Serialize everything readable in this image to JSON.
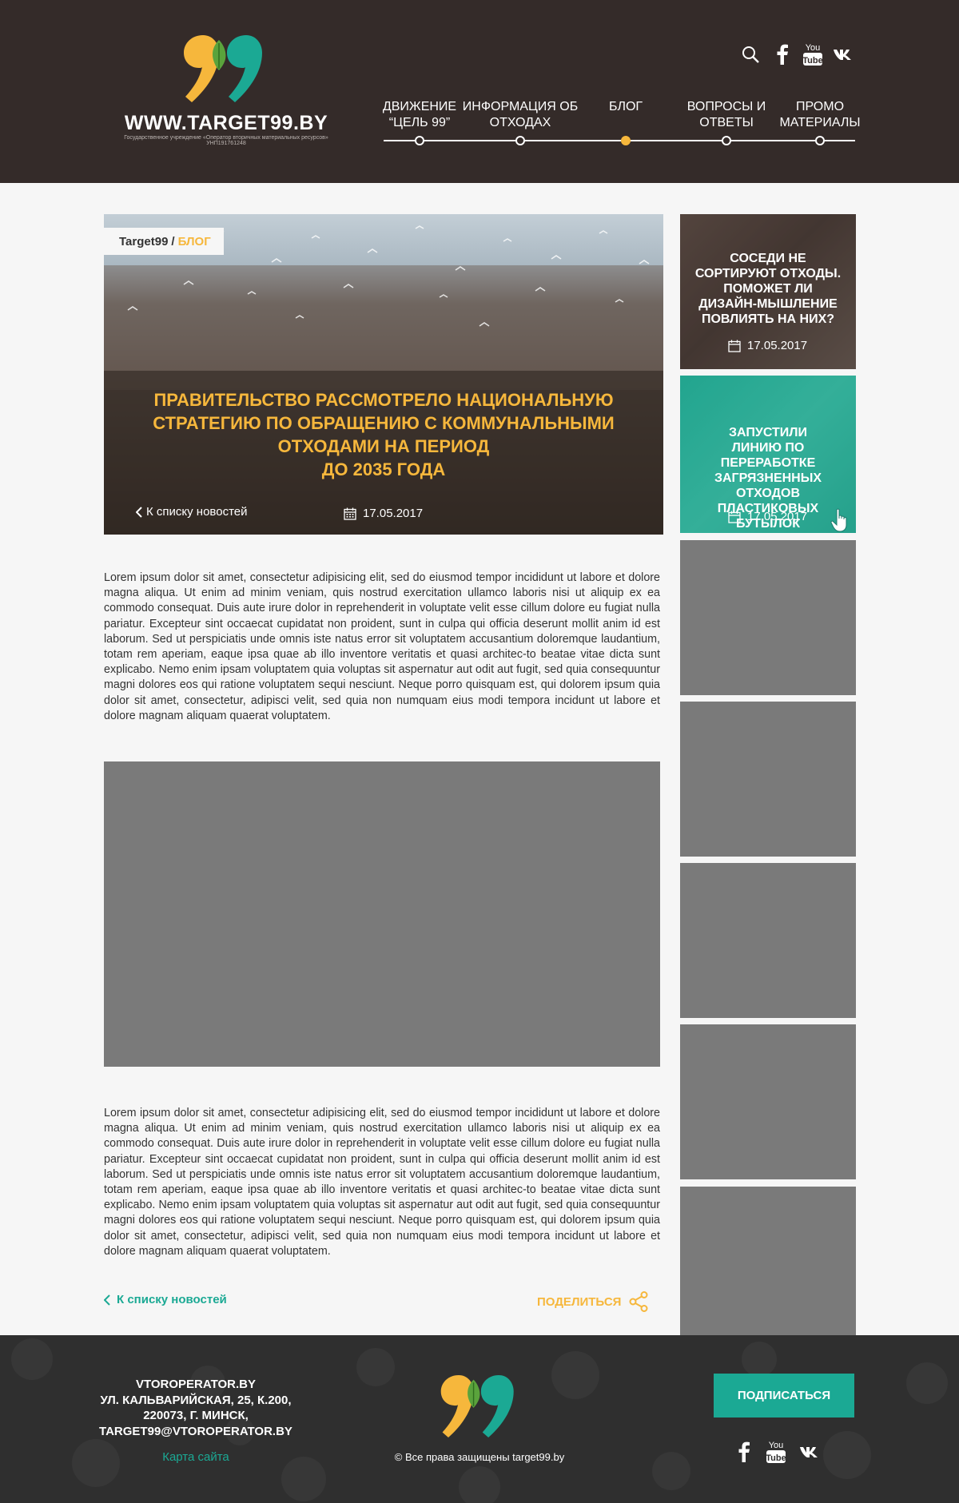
{
  "header": {
    "site_name": "WWW.TARGET99.BY",
    "site_subtitle": "Государственное учреждение «Оператор вторичных материальных ресурсов» УНП191761248",
    "social": [
      "search-icon",
      "facebook-icon",
      "youtube-icon",
      "vk-icon"
    ],
    "nav": [
      {
        "label_line1": "ДВИЖЕНИЕ",
        "label_line2": "“ЦЕЛЬ 99”",
        "active": false
      },
      {
        "label_line1": "ИНФОРМАЦИЯ ОБ",
        "label_line2": "ОТХОДАХ",
        "active": false
      },
      {
        "label_line1": "БЛОГ",
        "label_line2": "",
        "active": true
      },
      {
        "label_line1": "ВОПРОСЫ И",
        "label_line2": "ОТВЕТЫ",
        "active": false
      },
      {
        "label_line1": "ПРОМО",
        "label_line2": "МАТЕРИАЛЫ",
        "active": false
      }
    ]
  },
  "hero": {
    "breadcrumb_root": "Target99",
    "breadcrumb_sep": "/",
    "breadcrumb_current": "БЛОГ",
    "title_lines": [
      "ПРАВИТЕЛЬСТВО РАССМОТРЕЛО НАЦИОНАЛЬНУЮ",
      "СТРАТЕГИЮ ПО ОБРАЩЕНИЮ С КОММУНАЛЬНЫМИ",
      "ОТХОДАМИ НА ПЕРИОД",
      "ДО 2035 ГОДА"
    ],
    "back_label": "К списку новостей",
    "date": "17.05.2017"
  },
  "article": {
    "paragraph_1": "Lorem ipsum dolor sit amet, consectetur adipisicing elit, sed do eiusmod tempor incididunt ut labore et dolore magna aliqua. Ut enim ad minim veniam, quis nostrud exercitation ullamco laboris nisi ut aliquip ex ea commodo consequat. Duis aute irure dolor in reprehenderit in voluptate velit esse cillum dolore eu fugiat nulla pariatur. Excepteur sint occaecat cupidatat non proident, sunt in culpa qui officia deserunt mollit anim id est laborum. Sed ut perspiciatis unde omnis iste natus error sit voluptatem accusantium doloremque laudantium, totam rem aperiam, eaque ipsa quae ab illo inventore veritatis et quasi architec-to beatae vitae dicta sunt explicabo. Nemo enim ipsam voluptatem quia voluptas sit aspernatur aut odit aut fugit, sed quia consequuntur magni dolores eos qui ratione voluptatem sequi nesciunt. Neque porro quisquam est, qui dolorem ipsum quia dolor sit amet, consectetur, adipisci velit, sed quia non numquam eius modi tempora incidunt ut labore et dolore magnam aliquam quaerat voluptatem.",
    "paragraph_2": "Lorem ipsum dolor sit amet, consectetur adipisicing elit, sed do eiusmod tempor incididunt ut labore et dolore magna aliqua. Ut enim ad minim veniam, quis nostrud exercitation ullamco laboris nisi ut aliquip ex ea commodo consequat. Duis aute irure dolor in reprehenderit in voluptate velit esse cillum dolore eu fugiat nulla pariatur. Excepteur sint occaecat cupidatat non proident, sunt in culpa qui officia deserunt mollit anim id est laborum. Sed ut perspiciatis unde omnis iste natus error sit voluptatem accusantium doloremque laudantium, totam rem aperiam, eaque ipsa quae ab illo inventore veritatis et quasi architec-to beatae vitae dicta sunt explicabo. Nemo enim ipsam voluptatem quia voluptas sit aspernatur aut odit aut fugit, sed quia consequuntur magni dolores eos qui ratione voluptatem sequi nesciunt. Neque porro quisquam est, qui dolorem ipsum quia dolor sit amet, consectetur, adipisci velit, sed quia non numquam eius modi tempora incidunt ut labore et dolore magnam aliquam quaerat voluptatem.",
    "back_label": "К списку новостей",
    "share_label": "ПОДЕЛИТЬСЯ"
  },
  "sidebar": {
    "card_1": {
      "title_lines": [
        "СОСЕДИ НЕ",
        "СОРТИРУЮТ ОТХОДЫ.",
        "ПОМОЖЕТ ЛИ",
        "ДИЗАЙН-МЫШЛЕНИЕ",
        "ПОВЛИЯТЬ НА НИХ?"
      ],
      "date": "17.05.2017"
    },
    "card_2": {
      "title_lines": [
        "ЗАПУСТИЛИ",
        "ЛИНИЮ ПО ПЕРЕРАБОТКЕ",
        "ЗАГРЯЗНЕННЫХ ОТХОДОВ",
        "ПЛАСТИКОВЫХ БУТЫЛОК"
      ],
      "date": "17.05.2017"
    }
  },
  "footer": {
    "address_lines": [
      "VTOROPERATOR.BY",
      "УЛ. КАЛЬВАРИЙСКАЯ, 25, К.200,",
      "220073, Г. МИНСК,",
      "TARGET99@VTOROPERATOR.BY"
    ],
    "sitemap_label": "Карта сайта",
    "copyright": "© Все права защищены target99.by",
    "subscribe_label": "ПОДПИСАТЬСЯ",
    "social": [
      "facebook-icon",
      "youtube-icon",
      "vk-icon"
    ]
  },
  "colors": {
    "header_bg": "#342b29",
    "accent_yellow": "#f6b73c",
    "accent_teal": "#1ba994",
    "placeholder_grey": "#7a7a7a",
    "footer_bg": "#2f2f2f"
  }
}
